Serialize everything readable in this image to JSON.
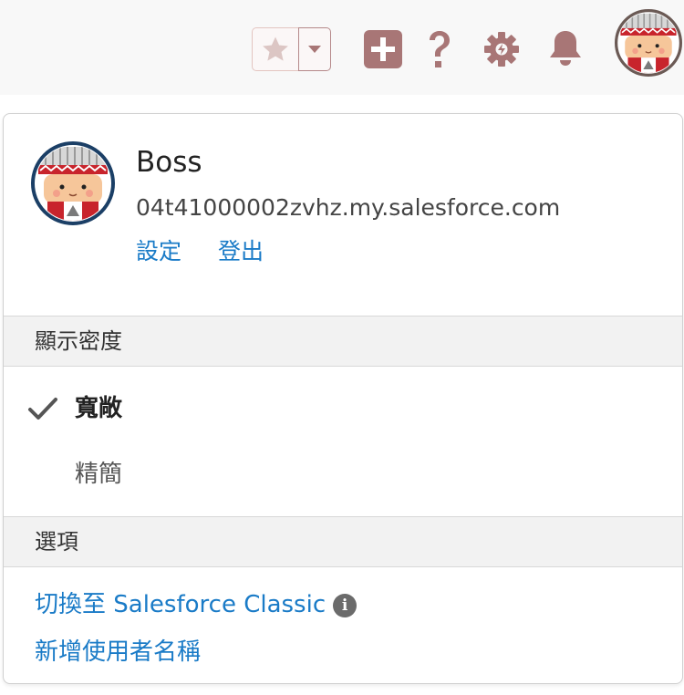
{
  "header": {
    "icons": [
      "star-icon",
      "chevron-down-icon",
      "add-icon",
      "help-icon",
      "setup-gear-icon",
      "notification-bell-icon"
    ],
    "accent_color": "#b5898a"
  },
  "user": {
    "name": "Boss",
    "domain": "04t41000002zvhz.my.salesforce.com",
    "settings_label": "設定",
    "logout_label": "登出"
  },
  "density": {
    "header": "顯示密度",
    "options": [
      {
        "label": "寬敞",
        "selected": true
      },
      {
        "label": "精簡",
        "selected": false
      }
    ]
  },
  "options": {
    "header": "選項",
    "switch_classic_label": "切換至 Salesforce Classic",
    "add_username_label": "新增使用者名稱"
  },
  "colors": {
    "link": "#1a7bc7",
    "section_bg": "#f2f2f2"
  }
}
